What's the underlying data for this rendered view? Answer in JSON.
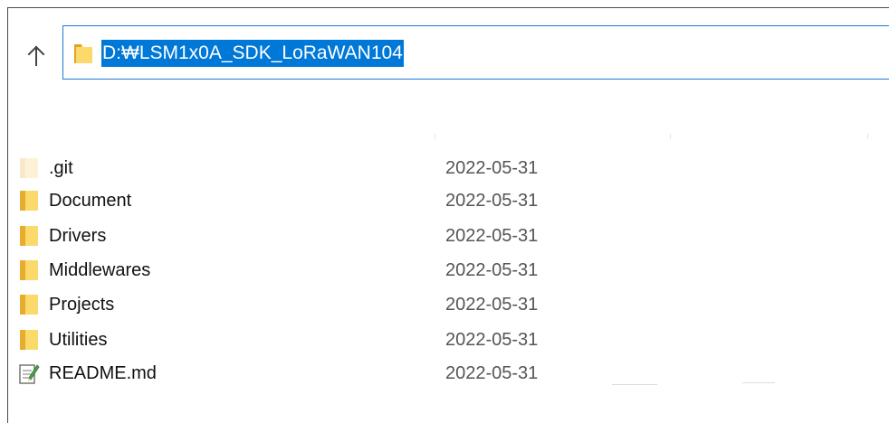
{
  "address_bar": {
    "path": "D:₩LSM1x0A_SDK_LoRaWAN104"
  },
  "icons": {
    "up": "up-arrow-icon",
    "folder": "folder-icon",
    "text_file": "text-file-icon"
  },
  "colors": {
    "selection": "#0078d7",
    "address_border": "#1f7ad8",
    "folder_yellow": "#f8d775"
  },
  "files": [
    {
      "name": ".git",
      "date": "2022-05-31",
      "type": "folder",
      "hidden": true
    },
    {
      "name": "Document",
      "date": "2022-05-31",
      "type": "folder"
    },
    {
      "name": "Drivers",
      "date": "2022-05-31",
      "type": "folder"
    },
    {
      "name": "Middlewares",
      "date": "2022-05-31",
      "type": "folder"
    },
    {
      "name": "Projects",
      "date": "2022-05-31",
      "type": "folder"
    },
    {
      "name": "Utilities",
      "date": "2022-05-31",
      "type": "folder"
    },
    {
      "name": "README.md",
      "date": "2022-05-31",
      "type": "text-file"
    }
  ]
}
